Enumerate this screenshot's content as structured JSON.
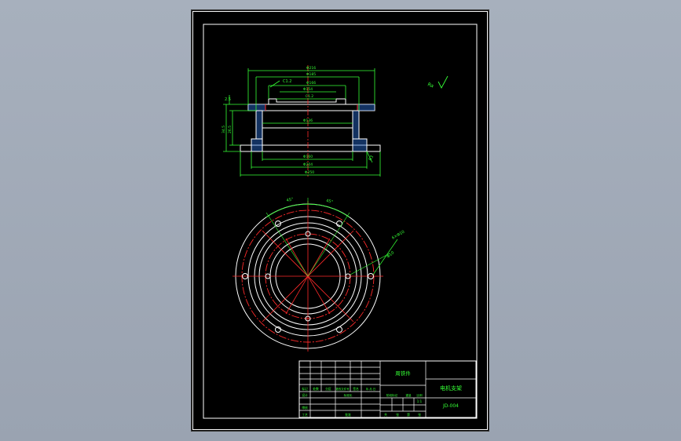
{
  "drawing": {
    "dimensions": {
      "d_top_outer": "Φ216",
      "d_top_mid": "Φ185",
      "d_top_inner": "Φ166",
      "d_flange": "Φ154",
      "angle_c1": "C1.2",
      "angle_c2": "C1.2",
      "thk_top": "2.5",
      "h_total": "34.5",
      "h_mid": "26.5",
      "d_bore": "Φ136",
      "d_bottom_1": "Φ160",
      "d_bottom_2": "Φ204",
      "d_bottom_3": "Φ250",
      "chamfer_r": "R3",
      "angle_1": "45°",
      "angle_2": "45°",
      "hole_note_1": "6×Φ10",
      "hole_note_2": "Φ10",
      "roughness": "Ra"
    },
    "title_block": {
      "part_category": "周铁件",
      "drawing_title": "电机支架",
      "drawing_no": "JD-004",
      "scale": "1:1",
      "sheet_labels": [
        "共",
        "张",
        "第",
        "张"
      ],
      "row_labels": [
        "标记",
        "处数",
        "分区",
        "更改文件号",
        "签名",
        "年.月.日"
      ],
      "role_labels": [
        "设计",
        "标准化",
        "审核",
        "工艺",
        "批准"
      ],
      "mid_labels": [
        "阶段标记",
        "重量",
        "比例"
      ]
    },
    "colors": {
      "outline": "#ffffff",
      "dimension": "#35ff35",
      "center": "#ff2a2a",
      "hatch": "#4aa3ff",
      "background": "#000000"
    }
  }
}
